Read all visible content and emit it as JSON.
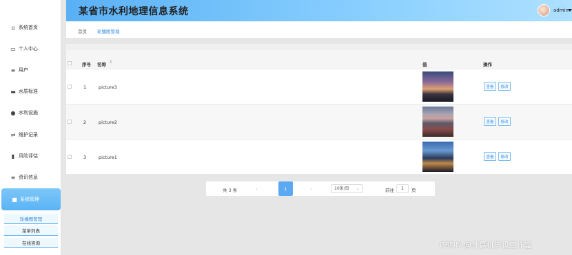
{
  "header": {
    "title": "某省市水利地理信息系统",
    "user": "admin"
  },
  "sidebar": {
    "items": [
      {
        "label": "系统首页",
        "icon": "home-icon"
      },
      {
        "label": "个人中心",
        "icon": "id-card-icon"
      },
      {
        "label": "用户",
        "icon": "list-icon"
      },
      {
        "label": "水质标准",
        "icon": "briefcase-icon"
      },
      {
        "label": "水利设施",
        "icon": "person-icon"
      },
      {
        "label": "维护记录",
        "icon": "sliders-icon"
      },
      {
        "label": "风险评估",
        "icon": "bar-chart-icon"
      },
      {
        "label": "资讯信息",
        "icon": "list-icon"
      },
      {
        "label": "系统管理",
        "icon": "folder-icon"
      }
    ],
    "active": "系统管理",
    "submenu": [
      "轮播图管理",
      "菜单列表",
      "在线咨询"
    ]
  },
  "breadcrumb": {
    "home": "首页",
    "current": "轮播图管理"
  },
  "table": {
    "headers": {
      "index": "序号",
      "name": "名称",
      "value": "值",
      "actions": "操作"
    },
    "rows": [
      {
        "index": "1",
        "name": "picture3"
      },
      {
        "index": "2",
        "name": "picture2"
      },
      {
        "index": "3",
        "name": "picture1"
      }
    ],
    "view_label": "查看",
    "edit_label": "修改"
  },
  "pagination": {
    "total": "共 3 条",
    "prev": "‹",
    "current": "1",
    "next": "›",
    "page_size": "10条/页",
    "goto_label": "前往",
    "goto_value": "1",
    "page_unit": "页"
  },
  "watermark": "CSDN @计算机毕设工作室",
  "colors": {
    "accent": "#5aa9f2",
    "header_start": "#5ab0f5",
    "header_end": "#aee0ff"
  }
}
